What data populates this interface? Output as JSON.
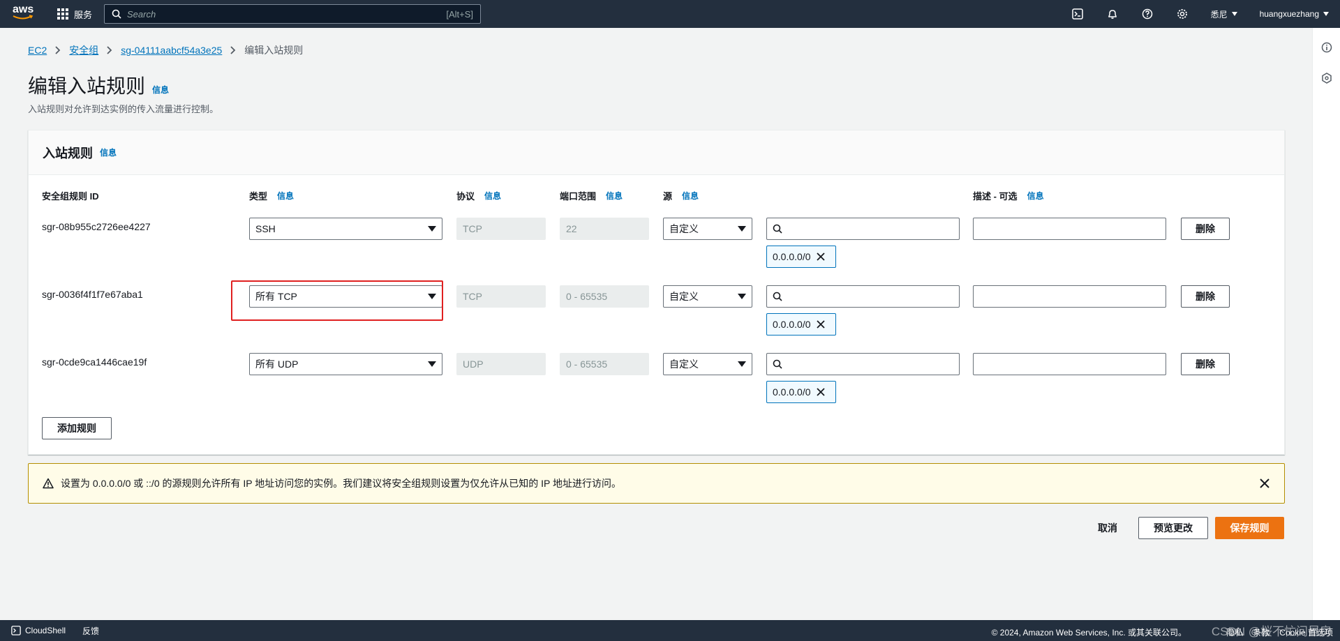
{
  "topnav": {
    "logo_text": "aws",
    "services_label": "服务",
    "search_placeholder": "Search",
    "search_shortcut": "[Alt+S]",
    "region_label": "悉尼",
    "user_label": "huangxuezhang"
  },
  "breadcrumb": {
    "items": [
      "EC2",
      "安全组",
      "sg-04111aabcf54a3e25"
    ],
    "current": "编辑入站规则"
  },
  "page": {
    "title": "编辑入站规则",
    "info": "信息",
    "description": "入站规则对允许到达实例的传入流量进行控制。"
  },
  "panel": {
    "title": "入站规则",
    "info": "信息",
    "columns": {
      "rule_id": "安全组规则 ID",
      "type": "类型",
      "protocol": "协议",
      "port_range": "端口范围",
      "source": "源",
      "description": "描述 - 可选",
      "info": "信息"
    },
    "rules": [
      {
        "id": "sgr-08b955c2726ee4227",
        "type": "SSH",
        "protocol": "TCP",
        "port": "22",
        "source": "自定义",
        "cidr": "0.0.0.0/0",
        "delete": "删除"
      },
      {
        "id": "sgr-0036f4f1f7e67aba1",
        "type": "所有 TCP",
        "protocol": "TCP",
        "port": "0 - 65535",
        "source": "自定义",
        "cidr": "0.0.0.0/0",
        "delete": "删除"
      },
      {
        "id": "sgr-0cde9ca1446cae19f",
        "type": "所有 UDP",
        "protocol": "UDP",
        "port": "0 - 65535",
        "source": "自定义",
        "cidr": "0.0.0.0/0",
        "delete": "删除"
      }
    ],
    "add_rule": "添加规则"
  },
  "warning": {
    "text": "设置为 0.0.0.0/0 或 ::/0 的源规则允许所有 IP 地址访问您的实例。我们建议将安全组规则设置为仅允许从已知的 IP 地址进行访问。"
  },
  "actions": {
    "cancel": "取消",
    "preview": "预览更改",
    "save": "保存规则"
  },
  "bottombar": {
    "cloudshell": "CloudShell",
    "feedback": "反馈",
    "copyright": "© 2024, Amazon Web Services, Inc. 或其关联公司。",
    "links": [
      "隐私",
      "条款",
      "Cookie 首选项"
    ],
    "watermark": "CSDN @桜不忙问昼房"
  },
  "colors": {
    "nav_bg": "#232f3e",
    "link": "#0073bb",
    "primary": "#ec7211",
    "highlight_border": "#e02020",
    "warning_bg": "#fffce8"
  }
}
